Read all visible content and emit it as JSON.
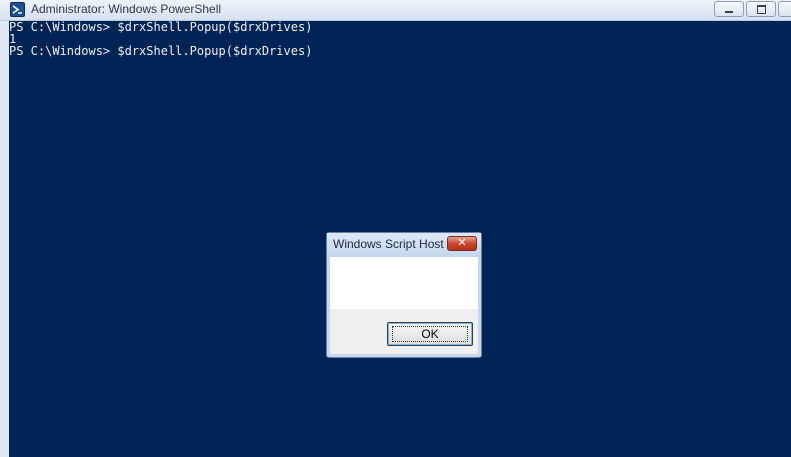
{
  "window": {
    "title": "Administrator: Windows PowerShell",
    "app_icon": "powershell-icon",
    "controls": {
      "minimize_icon": "minimize-icon",
      "maximize_icon": "maximize-icon",
      "close_icon": "close-icon"
    }
  },
  "console": {
    "background": "#012456",
    "foreground": "#eeedf0",
    "lines": [
      "PS C:\\Windows> $drxShell.Popup($drxDrives)",
      "1",
      "PS C:\\Windows> $drxShell.Popup($drxDrives)"
    ]
  },
  "dialog": {
    "title": "Windows Script Host",
    "message": "",
    "close_symbol": "✕",
    "ok_label": "OK"
  }
}
